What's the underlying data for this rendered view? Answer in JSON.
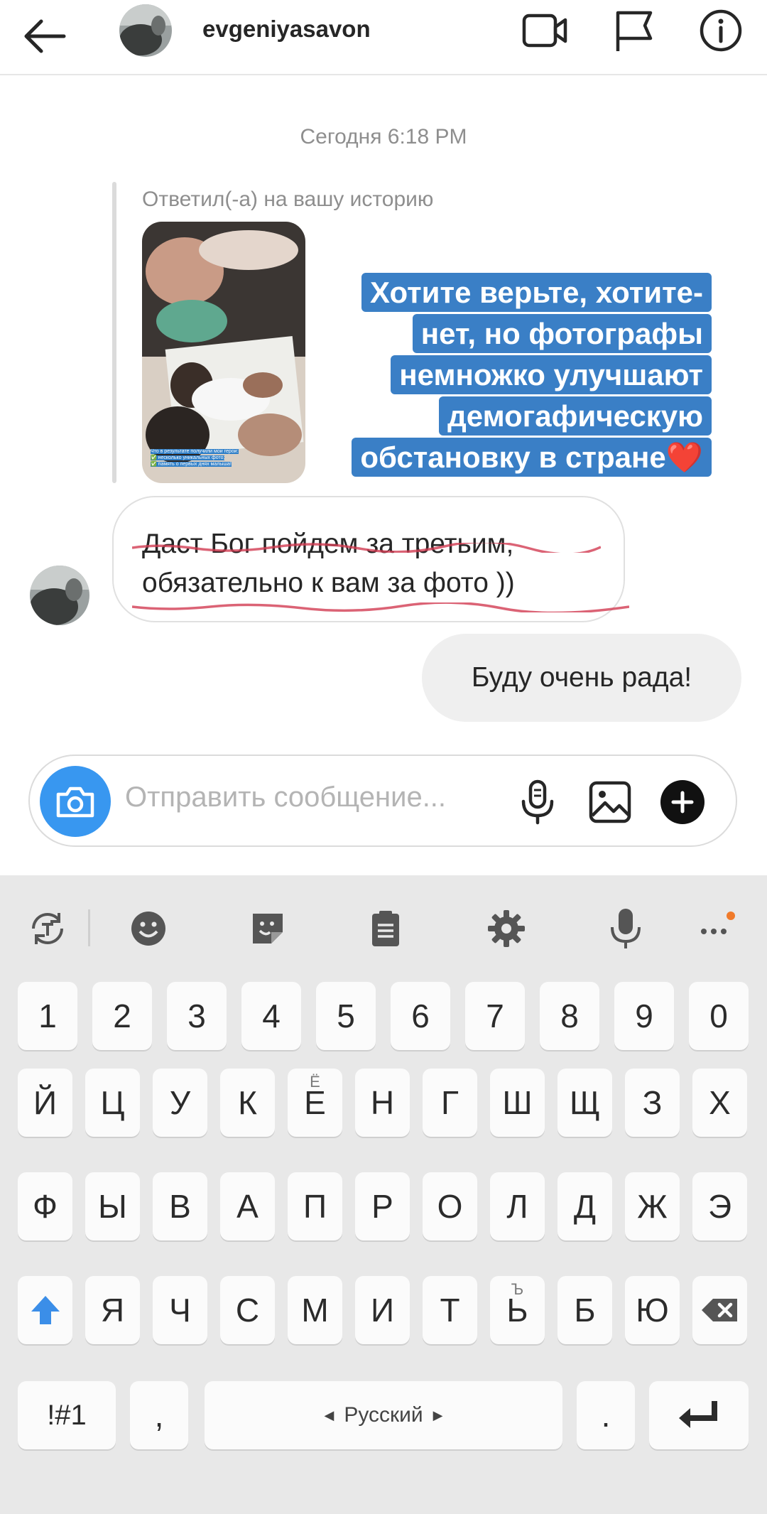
{
  "header": {
    "username": "evgeniyasavon",
    "icons": [
      "back-arrow-icon",
      "video-call-icon",
      "flag-icon",
      "info-icon"
    ]
  },
  "chat": {
    "timestamp": "Сегодня 6:18 PM",
    "reply_label": "Ответил(-а) на вашу историю",
    "story_caption": [
      "Что в результате получили мои герои:",
      "✅ несколько уникальных фото;",
      "✅ память о первых днях малыша!"
    ],
    "story_text": [
      "Хотите верьте, хотите-",
      "нет, но фотографы",
      "немножко улучшают",
      "демогафическую",
      "обстановку в стране"
    ],
    "story_heart": "❤️",
    "incoming_lines": [
      "Даст Бог пойдем за третьим,",
      "обязательно к вам за фото ))"
    ],
    "outgoing": "Буду очень рада!"
  },
  "composer": {
    "placeholder": "Отправить сообщение..."
  },
  "keyboard": {
    "toolbar_icons": [
      "text-transform-icon",
      "emoji-icon",
      "sticker-icon",
      "clipboard-icon",
      "settings-icon",
      "voice-input-icon",
      "more-icon"
    ],
    "row1": [
      "1",
      "2",
      "3",
      "4",
      "5",
      "6",
      "7",
      "8",
      "9",
      "0"
    ],
    "row2": [
      "Й",
      "Ц",
      "У",
      "К",
      "Е",
      "Н",
      "Г",
      "Ш",
      "Щ",
      "З",
      "Х"
    ],
    "row2_hints": {
      "Е": "Ё"
    },
    "row3": [
      "Ф",
      "Ы",
      "В",
      "А",
      "П",
      "Р",
      "О",
      "Л",
      "Д",
      "Ж",
      "Э"
    ],
    "row4": [
      "Я",
      "Ч",
      "С",
      "М",
      "И",
      "Т",
      "Ь",
      "Б",
      "Ю"
    ],
    "row4_hints": {
      "Ь": "Ъ"
    },
    "symbols_label": "!#1",
    "comma": ",",
    "space_label": "Русский",
    "period": "."
  }
}
